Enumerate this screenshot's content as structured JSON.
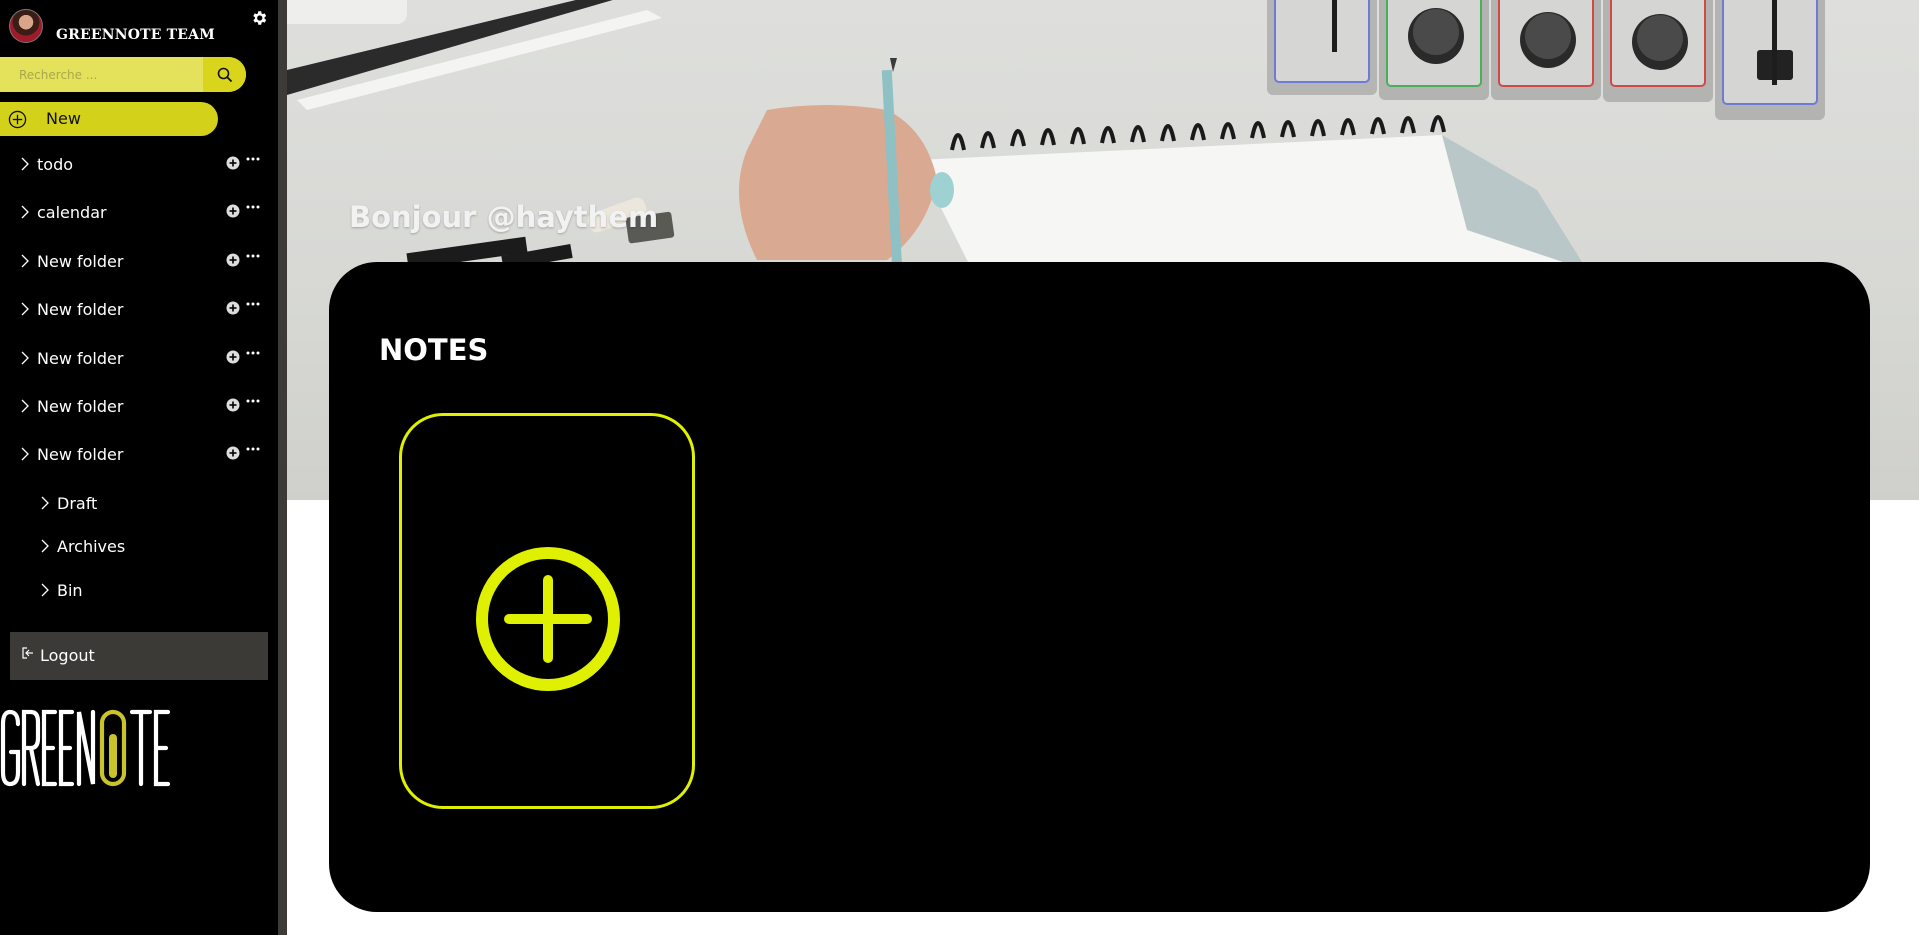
{
  "sidebar": {
    "team_name": "GREENNOTE TEAM",
    "search": {
      "placeholder": "Recherche ..."
    },
    "new_label": "New",
    "folders": [
      {
        "label": "todo"
      },
      {
        "label": "calendar"
      },
      {
        "label": "New folder"
      },
      {
        "label": "New folder"
      },
      {
        "label": "New folder"
      },
      {
        "label": "New folder"
      },
      {
        "label": "New folder"
      }
    ],
    "sections": [
      {
        "label": "Draft"
      },
      {
        "label": "Archives"
      },
      {
        "label": "Bin"
      }
    ],
    "logout_label": "Logout",
    "brand": "GREENOTE"
  },
  "main": {
    "greeting": "Bonjour @haythem",
    "notes_title": "NOTES"
  },
  "colors": {
    "accent": "#dff000",
    "sidebar_bg": "#000000",
    "search_bg": "#e0de4f",
    "logout_bg": "#3b3a36"
  }
}
